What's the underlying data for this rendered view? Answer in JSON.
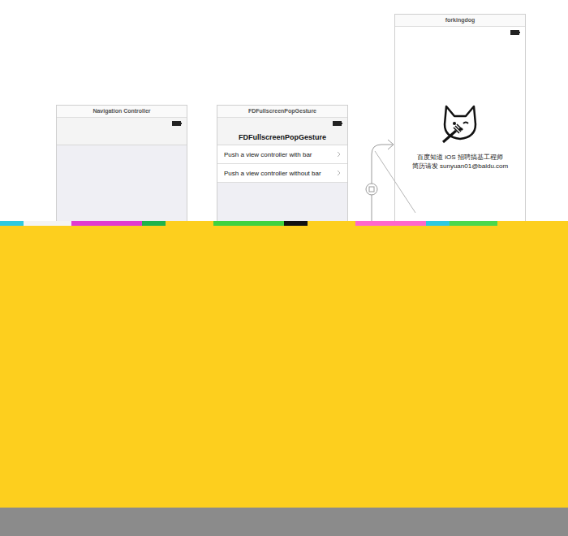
{
  "scenes": [
    {
      "title": "Navigation Controller"
    },
    {
      "title": "FDFullscreenPopGesture",
      "nav_title": "FDFullscreenPopGesture",
      "rows": [
        {
          "label": "Push a view controller with bar"
        },
        {
          "label": "Push a view controller without bar"
        }
      ]
    },
    {
      "title": "forkingdog",
      "lines": [
        "百度知道 iOS 招聘搞基工程师",
        "简历请发 sunyuan01@baidu.com"
      ]
    }
  ]
}
